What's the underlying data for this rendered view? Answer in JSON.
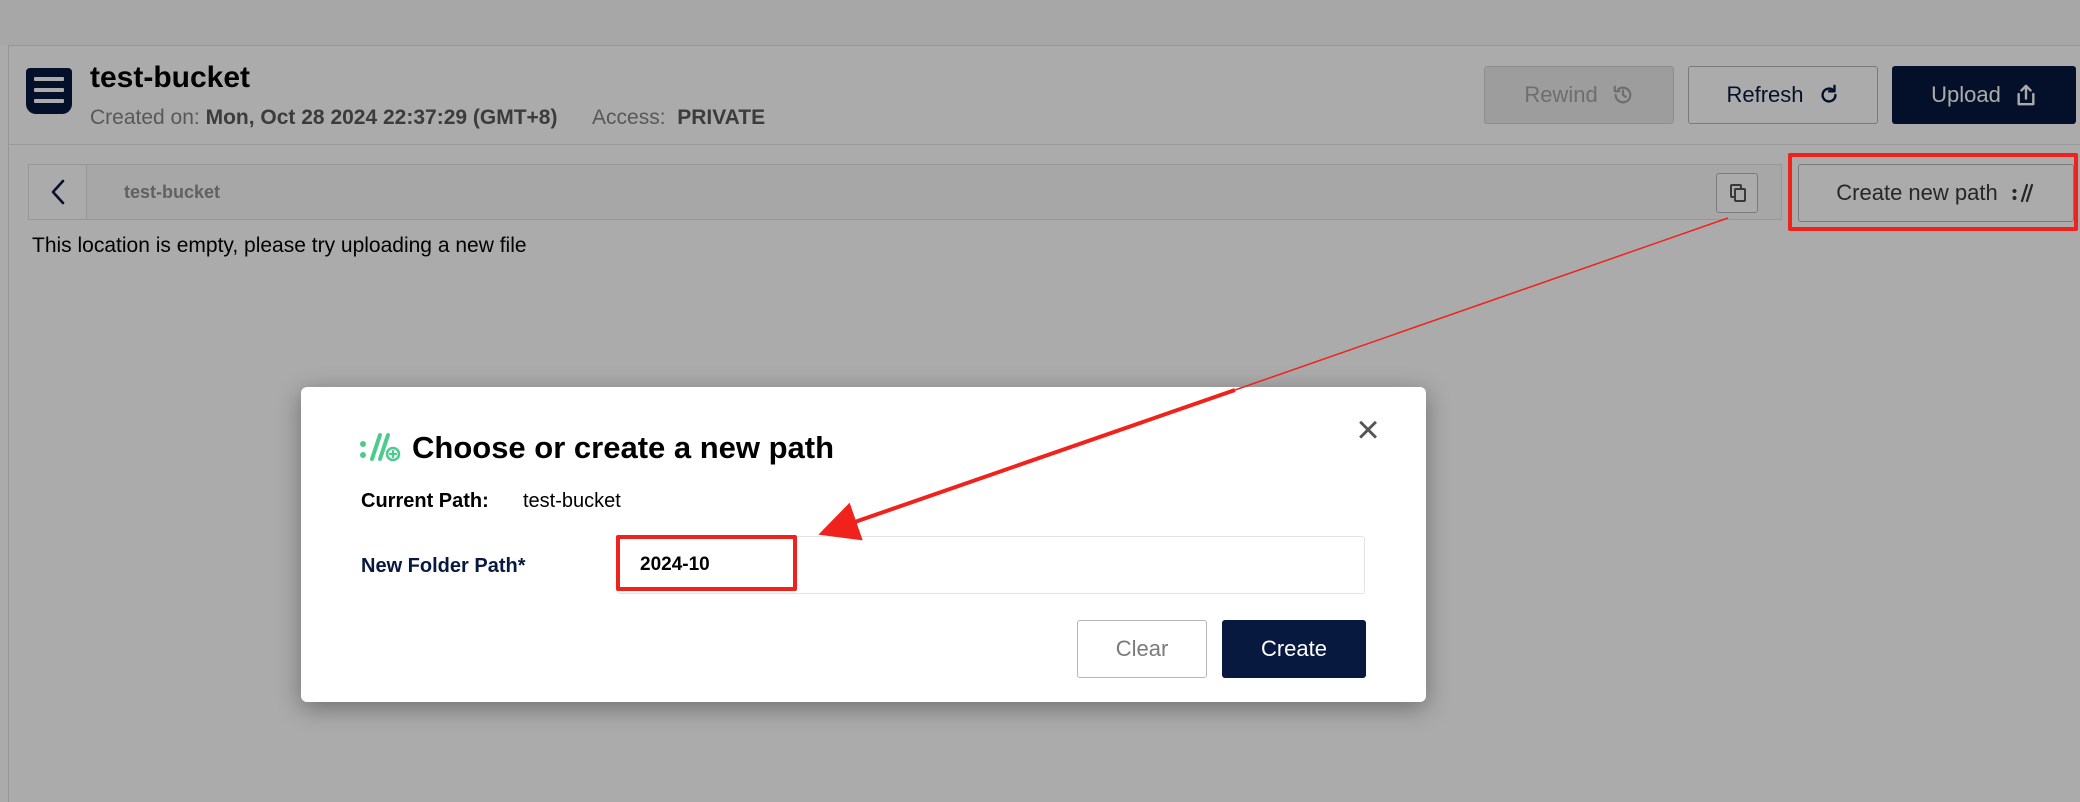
{
  "bucket": {
    "name": "test-bucket",
    "created_label": "Created on:",
    "created_value": "Mon, Oct 28 2024 22:37:29 (GMT+8)",
    "access_label": "Access:",
    "access_value": "PRIVATE"
  },
  "toolbar": {
    "rewind_label": "Rewind",
    "refresh_label": "Refresh",
    "upload_label": "Upload",
    "create_path_label": "Create new path"
  },
  "breadcrumb": {
    "path": "test-bucket"
  },
  "empty_message": "This location is empty, please try uploading a new file",
  "modal": {
    "title": "Choose or create a new path",
    "current_path_label": "Current Path:",
    "current_path_value": "test-bucket",
    "new_folder_label": "New Folder Path*",
    "new_folder_value": "2024-10",
    "clear_label": "Clear",
    "create_label": "Create",
    "close_glyph": "×"
  },
  "colors": {
    "primary": "#07193e",
    "accent_green": "#4ccb8d",
    "annotation_red": "#f0221c"
  },
  "icons": [
    "bucket-icon",
    "history-icon",
    "refresh-icon",
    "upload-icon",
    "chevron-left-icon",
    "copy-icon",
    "new-path-icon",
    "close-icon"
  ]
}
